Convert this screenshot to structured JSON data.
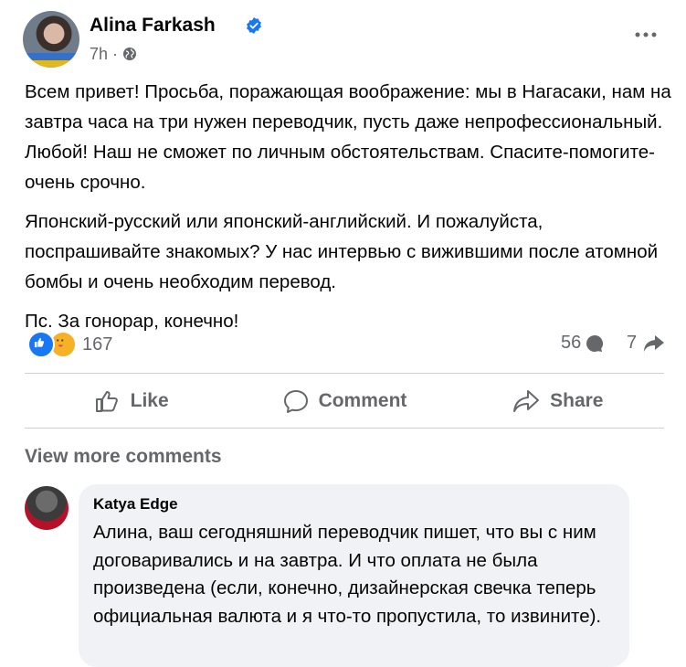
{
  "post": {
    "author": "Alina Farkash",
    "time": "7h",
    "paragraphs": [
      "Всем привет! Просьба, поражающая воображение: мы в Нагасаки, нам на завтра часа на три нужен переводчик, пусть даже непрофессиональный. Любой! Наш не сможет по личным обстоятельствам. Спасите-помогите-очень срочно.",
      "Японский-русский или японский-английский. И пожалуйста, поспрашивайте знакомых? У нас интервью с вижившими после атомной бомбы и очень необходим перевод.",
      "Пс. За гонорар, конечно!"
    ],
    "reactions_count": "167",
    "comments_count": "56",
    "shares_count": "7"
  },
  "actions": {
    "like": "Like",
    "comment": "Comment",
    "share": "Share"
  },
  "view_more_comments": "View more comments",
  "comment": {
    "author": "Katya Edge",
    "text": "Алина, ваш сегодняшний переводчик пишет, что вы с ним договаривались и на завтра. И что оплата не была произведена (если, конечно, дизайнерская свечка теперь официальная валюта и я что-то пропустила, то извините)."
  },
  "icons": {
    "verified": "verified-badge-icon",
    "audience": "globe-icon",
    "more": "more-options-icon",
    "like": "thumbs-up-icon",
    "comment": "comment-bubble-icon",
    "share": "share-arrow-icon"
  },
  "colors": {
    "accent": "#1877f2",
    "secondary_text": "#65676b",
    "comment_bg": "#f0f2f5"
  }
}
